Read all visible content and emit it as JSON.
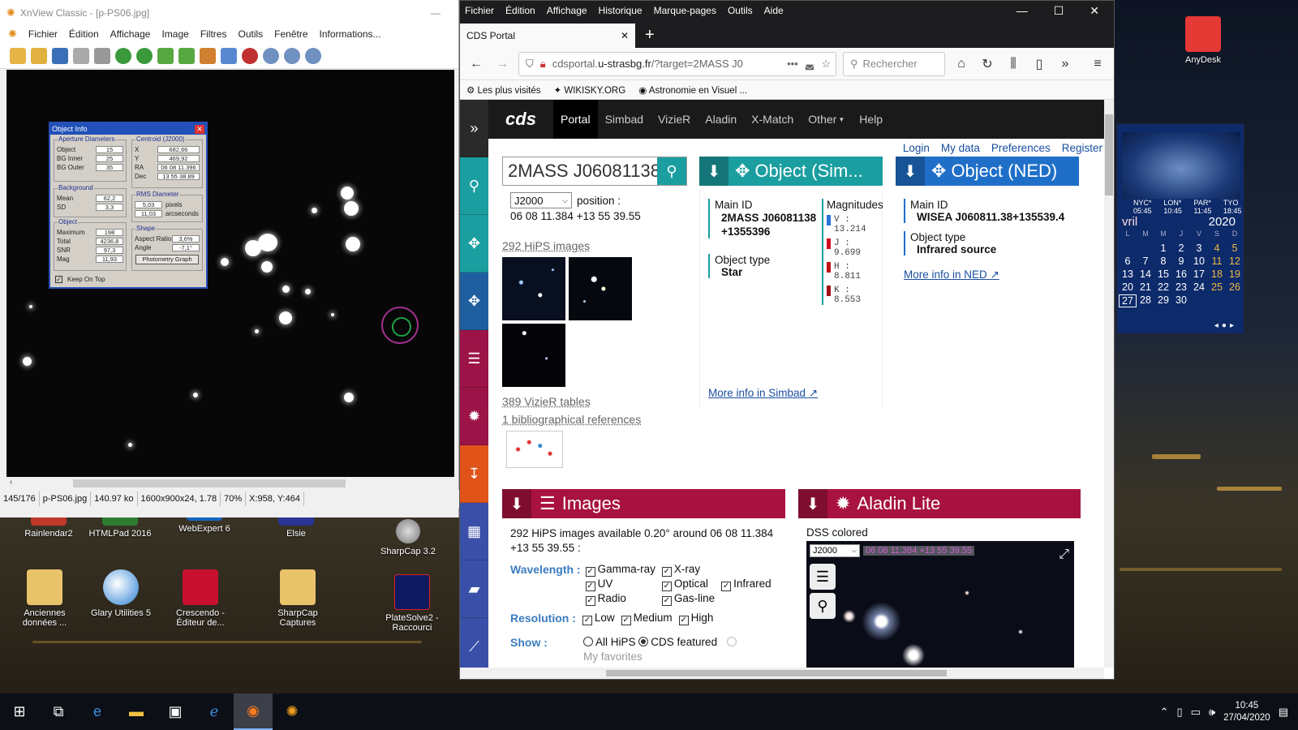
{
  "xnview": {
    "title": "XnView Classic - [p-PS06.jpg]",
    "menu": [
      "Fichier",
      "Édition",
      "Affichage",
      "Image",
      "Filtres",
      "Outils",
      "Fenêtre",
      "Informations..."
    ],
    "status": [
      "145/176",
      "p-PS06.jpg",
      "140.97 ko",
      "1600x900x24, 1.78",
      "70%",
      "X:958, Y:464"
    ],
    "objinfo": {
      "title": "Object Info",
      "aperture_h": "Aperture Diameters",
      "centroid_h": "Centroid (J2000)",
      "background_h": "Background",
      "rms_h": "RMS Diameter",
      "object_h": "Object",
      "shape_h": "Shape",
      "aperture": [
        {
          "label": "Object",
          "value": "15"
        },
        {
          "label": "BG Inner",
          "value": "25"
        },
        {
          "label": "BG Outer",
          "value": "35"
        }
      ],
      "centroid": [
        {
          "label": "X",
          "value": "682,66"
        },
        {
          "label": "Y",
          "value": "469,92"
        },
        {
          "label": "RA",
          "value": "06 08 11.396"
        },
        {
          "label": "Dec",
          "value": "13 55 38.89"
        }
      ],
      "background": [
        {
          "label": "Mean",
          "value": "62,2"
        },
        {
          "label": "SD",
          "value": "3,3"
        }
      ],
      "rms": [
        {
          "value": "5,03",
          "unit": "pixels"
        },
        {
          "value": "11,03",
          "unit": "arcseconds"
        }
      ],
      "object": [
        {
          "label": "Maximum",
          "value": "198"
        },
        {
          "label": "Total",
          "value": "4236,8"
        },
        {
          "label": "SNR",
          "value": "97,3"
        },
        {
          "label": "Mag",
          "value": "11,93"
        }
      ],
      "shape": [
        {
          "label": "Aspect Ratio",
          "value": "3,6%"
        },
        {
          "label": "Angle",
          "value": "-7,1°"
        }
      ],
      "photometry_btn": "Photometry Graph",
      "keep_on_top": "Keep On Top"
    }
  },
  "desktop_icons": [
    {
      "label": "Rainlendar2"
    },
    {
      "label": "HTMLPad 2016"
    },
    {
      "label": "WebExpert 6"
    },
    {
      "label": "Elsie"
    },
    {
      "label": "SharpCap 3.2"
    },
    {
      "label": "Anciennes données ..."
    },
    {
      "label": "Glary Utilities 5"
    },
    {
      "label": "Crescendo - Éditeur de..."
    },
    {
      "label": "SharpCap Captures"
    },
    {
      "label": "PlateSolve2 - Raccourci"
    },
    {
      "label": "AnyDesk"
    }
  ],
  "firefox": {
    "menu": [
      "Fichier",
      "Édition",
      "Affichage",
      "Historique",
      "Marque-pages",
      "Outils",
      "Aide"
    ],
    "tab_title": "CDS Portal",
    "url_host": "cdsportal.",
    "url_domain": "u-strasbg.fr",
    "url_path": "/?target=2MASS J0",
    "search_placeholder": "Rechercher",
    "bookmarks": [
      "Les plus visités",
      "WIKISKY.ORG",
      "Astronomie en Visuel ..."
    ]
  },
  "cds": {
    "logo": "cds",
    "nav": [
      "Portal",
      "Simbad",
      "VizieR",
      "Aladin",
      "X-Match",
      "Other",
      "Help"
    ],
    "userlinks": [
      "Login",
      "My data",
      "Preferences",
      "Register"
    ],
    "search_value": "2MASS J06081138",
    "equinox": "J2000",
    "position_label": "position :",
    "position": "06 08 11.384 +13 55 39.55",
    "hips_link": "292 HiPS images",
    "vizier_link": "389 VizieR tables",
    "biblio_link": "1 bibliographical references",
    "simbad": {
      "header": "Object (Sim...",
      "main_id_label": "Main ID",
      "main_id": "2MASS J06081138+1355396",
      "type_label": "Object type",
      "type": "Star",
      "mags_label": "Magnitudes",
      "mags": [
        {
          "band": "V :",
          "value": "13.214",
          "color": "#2a74d8"
        },
        {
          "band": "J :",
          "value": "9.699",
          "color": "#d01020"
        },
        {
          "band": "H :",
          "value": "8.811",
          "color": "#c01018"
        },
        {
          "band": "K :",
          "value": "8.553",
          "color": "#a0101a"
        }
      ],
      "more": "More info in Simbad"
    },
    "ned": {
      "header": "Object (NED)",
      "main_id_label": "Main ID",
      "main_id": "WISEA J060811.38+135539.4",
      "type_label": "Object type",
      "type": "Infrared source",
      "more": "More info in NED"
    },
    "images": {
      "header": "Images",
      "desc": "292 HiPS images available 0.20° around 06 08 11.384 +13 55 39.55 :",
      "wavelength_label": "Wavelength :",
      "wavelengths": [
        "Gamma-ray",
        "X-ray",
        "UV",
        "Optical",
        "Infrared",
        "Radio",
        "Gas-line"
      ],
      "resolution_label": "Resolution :",
      "resolutions": [
        "Low",
        "Medium",
        "High"
      ],
      "show_label": "Show :",
      "show": [
        "All HiPS",
        "CDS featured",
        "My favorites"
      ]
    },
    "aladin": {
      "header": "Aladin Lite",
      "survey": "DSS colored",
      "equinox": "J2000",
      "coords": "06 08 11.384 +13 55 39.55"
    }
  },
  "rainlendar": {
    "cities": [
      "NYC* 05:45",
      "LON* 10:45",
      "PAR* 11:45",
      "TYO 18:45"
    ],
    "month": "vril",
    "year": "2020",
    "weekdays": [
      "L",
      "M",
      "M",
      "J",
      "V",
      "S",
      "D"
    ],
    "days": [
      "",
      "",
      "1",
      "2",
      "3",
      "4",
      "5",
      "6",
      "7",
      "8",
      "9",
      "10",
      "11",
      "12",
      "13",
      "14",
      "15",
      "16",
      "17",
      "18",
      "19",
      "20",
      "21",
      "22",
      "23",
      "24",
      "25",
      "26",
      "27",
      "28",
      "29",
      "30",
      "",
      "",
      ""
    ]
  },
  "taskbar": {
    "time": "10:45",
    "date": "27/04/2020"
  }
}
